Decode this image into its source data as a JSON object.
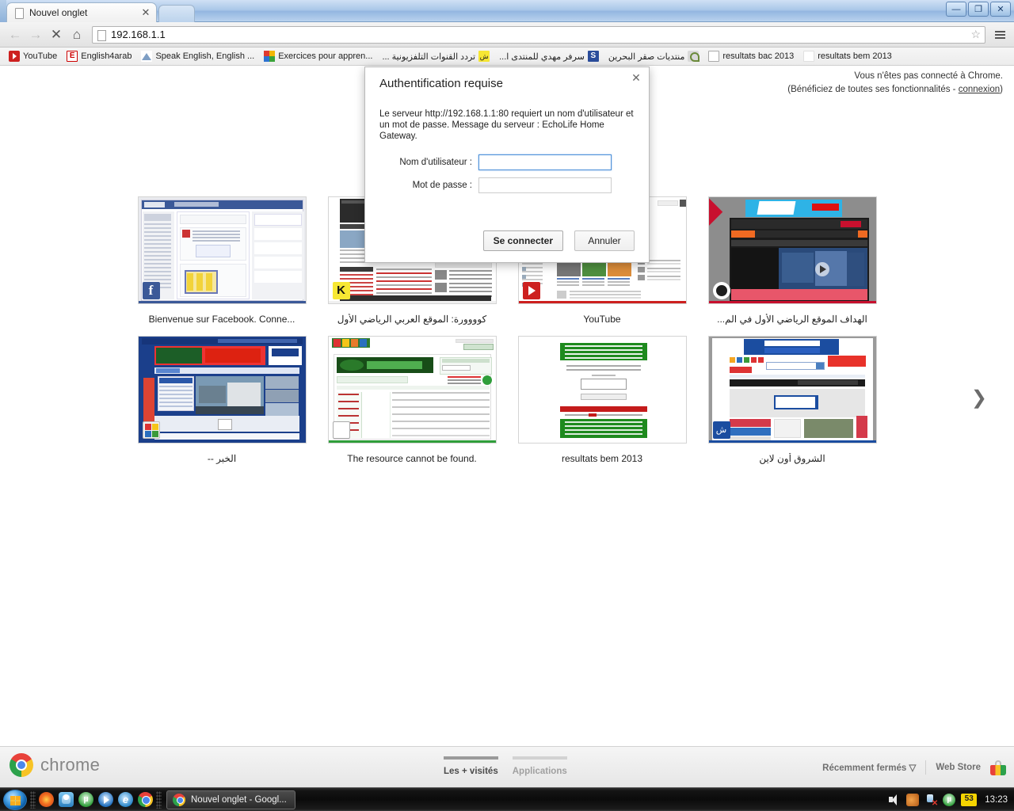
{
  "window": {
    "minimize_label": "—",
    "maximize_label": "❐",
    "close_label": "✕"
  },
  "tab": {
    "title": "Nouvel onglet",
    "close_label": "✕"
  },
  "toolbar": {
    "back_label": "←",
    "forward_label": "→",
    "stop_label": "✕",
    "home_label": "⌂",
    "star_label": "☆",
    "url": "192.168.1.1"
  },
  "bookmarks": [
    {
      "label": "YouTube",
      "icon": "youtube-icon",
      "rtl": false
    },
    {
      "label": "English4arab",
      "icon": "english4arab-icon",
      "rtl": false
    },
    {
      "label": "Speak English, English ...",
      "icon": "triangle-icon",
      "rtl": false
    },
    {
      "label": "Exercices pour appren...",
      "icon": "colorsquares-icon",
      "rtl": false
    },
    {
      "label": "تردد القنوات التلفزيونية ...",
      "icon": "yellow-arabic-icon",
      "rtl": true
    },
    {
      "label": "سرفر مهدي للمنتدى ا...",
      "icon": "blue-s-icon",
      "rtl": true
    },
    {
      "label": "منتديات صقر البحرين",
      "icon": "satellite-icon",
      "rtl": true
    },
    {
      "label": "resultats bac 2013",
      "icon": "document-icon",
      "rtl": false
    },
    {
      "label": "resultats bem 2013",
      "icon": "blank-icon",
      "rtl": false
    }
  ],
  "ntp": {
    "signin_line1": "Vous n'êtes pas connecté à Chrome.",
    "signin_line2_pre": "(Bénéficiez de toutes ses fonctionnalités - ",
    "signin_link": "connexion",
    "signin_line2_post": ")",
    "next_arrow": "❯",
    "tiles": [
      {
        "title": "Bienvenue sur Facebook. Conne...",
        "rtl": false,
        "badge": "facebook-badge",
        "accent": "#3b5998"
      },
      {
        "title": "كوووورة: الموقع العربي الرياضي الأول",
        "rtl": true,
        "badge": "kooora-badge",
        "accent": "#f4f4f4"
      },
      {
        "title": "YouTube",
        "rtl": false,
        "badge": "youtube-badge",
        "accent": "#cd201f"
      },
      {
        "title": "الهداف الموقع الرياضي الأول في الم...",
        "rtl": true,
        "badge": "elheddaf-badge",
        "accent": "#c8102e"
      },
      {
        "title": "الخبر --",
        "rtl": true,
        "badge": "elkhabar-badge",
        "accent": "#1b3f8b"
      },
      {
        "title": "The resource cannot be found.",
        "rtl": false,
        "badge": "document-badge",
        "accent": "#2f9e3a"
      },
      {
        "title": "resultats bem 2013",
        "rtl": false,
        "badge": "none",
        "accent": "#ffffff"
      },
      {
        "title": "الشروق أون لاين",
        "rtl": true,
        "badge": "echorouk-badge",
        "accent": "#1b4da0"
      }
    ],
    "bottom": {
      "brand": "chrome",
      "tab_most_visited": "Les + visités",
      "tab_apps": "Applications",
      "recently_closed": "Récemment fermés",
      "recently_closed_caret": "▽",
      "web_store": "Web Store"
    }
  },
  "dialog": {
    "title": "Authentification requise",
    "close_label": "✕",
    "message": "Le serveur http://192.168.1.1:80 requiert un nom d'utilisateur et un mot de passe. Message du serveur : EchoLife Home Gateway.",
    "username_label": "Nom d'utilisateur :",
    "username_value": "",
    "password_label": "Mot de passe :",
    "password_value": "",
    "submit_label": "Se connecter",
    "cancel_label": "Annuler"
  },
  "taskbar": {
    "quicklaunch": [
      "firefox-icon",
      "msn-messenger-icon",
      "utorrent-icon",
      "windows-media-player-icon",
      "internet-explorer-icon",
      "chrome-icon"
    ],
    "task_button_label": "Nouvel onglet - Googl...",
    "tray": [
      "volume-icon",
      "speaker-icon",
      "network-error-icon",
      "utorrent-tray-icon"
    ],
    "tray_number": "53",
    "clock": "13:23"
  }
}
